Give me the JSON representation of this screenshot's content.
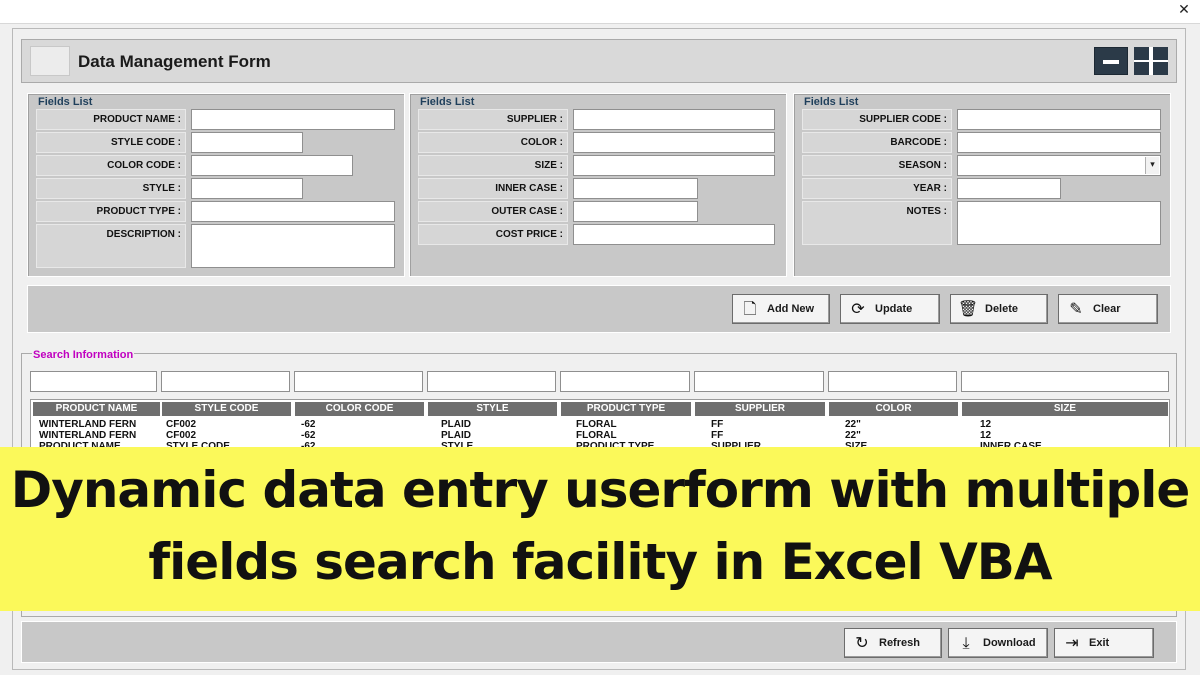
{
  "window": {
    "close_glyph": "✕"
  },
  "form": {
    "title": "Data Management Form"
  },
  "panels": [
    {
      "legend": "Fields List",
      "fields": [
        {
          "label": "PRODUCT NAME :",
          "value": ""
        },
        {
          "label": "STYLE CODE :",
          "value": ""
        },
        {
          "label": "COLOR CODE :",
          "value": ""
        },
        {
          "label": "STYLE :",
          "value": ""
        },
        {
          "label": "PRODUCT TYPE :",
          "value": ""
        },
        {
          "label": "DESCRIPTION :",
          "value": ""
        }
      ]
    },
    {
      "legend": "Fields List",
      "fields": [
        {
          "label": "SUPPLIER :",
          "value": ""
        },
        {
          "label": "COLOR :",
          "value": ""
        },
        {
          "label": "SIZE :",
          "value": ""
        },
        {
          "label": "INNER CASE :",
          "value": ""
        },
        {
          "label": "OUTER CASE :",
          "value": ""
        },
        {
          "label": "COST PRICE :",
          "value": ""
        }
      ]
    },
    {
      "legend": "Fields List",
      "fields": [
        {
          "label": "SUPPLIER CODE :",
          "value": ""
        },
        {
          "label": "BARCODE :",
          "value": ""
        },
        {
          "label": "SEASON :",
          "value": ""
        },
        {
          "label": "YEAR :",
          "value": ""
        },
        {
          "label": "NOTES :",
          "value": ""
        }
      ]
    }
  ],
  "actions": {
    "add_new": "Add New",
    "update": "Update",
    "delete": "Delete",
    "clear": "Clear"
  },
  "icons": {
    "add": "add-document-icon",
    "update": "refresh-arrows-icon",
    "delete": "trash-icon",
    "clear": "broom-icon",
    "refresh": "refresh-icon",
    "download": "download-icon",
    "exit": "exit-icon"
  },
  "search": {
    "legend": "Search Information",
    "columns": [
      "PRODUCT NAME",
      "STYLE CODE",
      "COLOR CODE",
      "STYLE",
      "PRODUCT TYPE",
      "SUPPLIER",
      "COLOR",
      "SIZE"
    ],
    "rows": [
      [
        "WINTERLAND FERN",
        "CF002",
        "-62",
        "PLAID",
        "FLORAL",
        "FF",
        "22\"",
        "12"
      ],
      [
        "WINTERLAND FERN",
        "CF002",
        "-62",
        "PLAID",
        "FLORAL",
        "FF",
        "22\"",
        "12"
      ],
      [
        "PRODUCT NAME",
        "STYLE CODE",
        "-62",
        "STYLE",
        "PRODUCT TYPE",
        "SUPPLIER",
        "SIZE",
        "INNER CASE"
      ]
    ]
  },
  "banner": {
    "line1": "Dynamic data entry userform with multiple",
    "line2": "fields search facility in Excel VBA"
  },
  "footer": {
    "refresh": "Refresh",
    "download": "Download",
    "exit": "Exit"
  },
  "colors": {
    "banner_bg": "#fbf95a",
    "panel_bg": "#c8c8c8",
    "legend_blue": "#1f3f5b",
    "search_legend_magenta": "#c000c0",
    "column_header_bg": "#6e6e6e"
  }
}
